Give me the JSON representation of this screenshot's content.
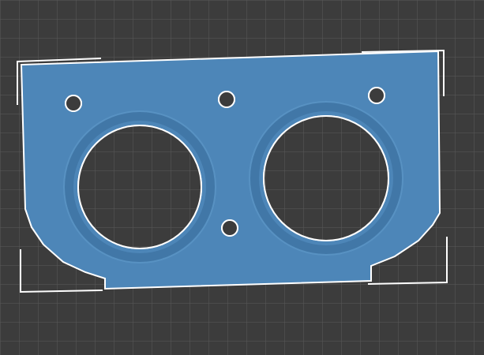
{
  "colors": {
    "background": "#3c3c3c",
    "grid_line": "#595959",
    "part_fill": "#4d86b8",
    "part_shade": "#3f74a3",
    "part_outline": "#ffffff",
    "boundary_corner": "#ffffff",
    "hole_fill": "#3c3c3c"
  },
  "icons": {
    "corner_bracket": "selection-bounds-corner-icon",
    "mounting_hole": "circle-hole-icon"
  }
}
